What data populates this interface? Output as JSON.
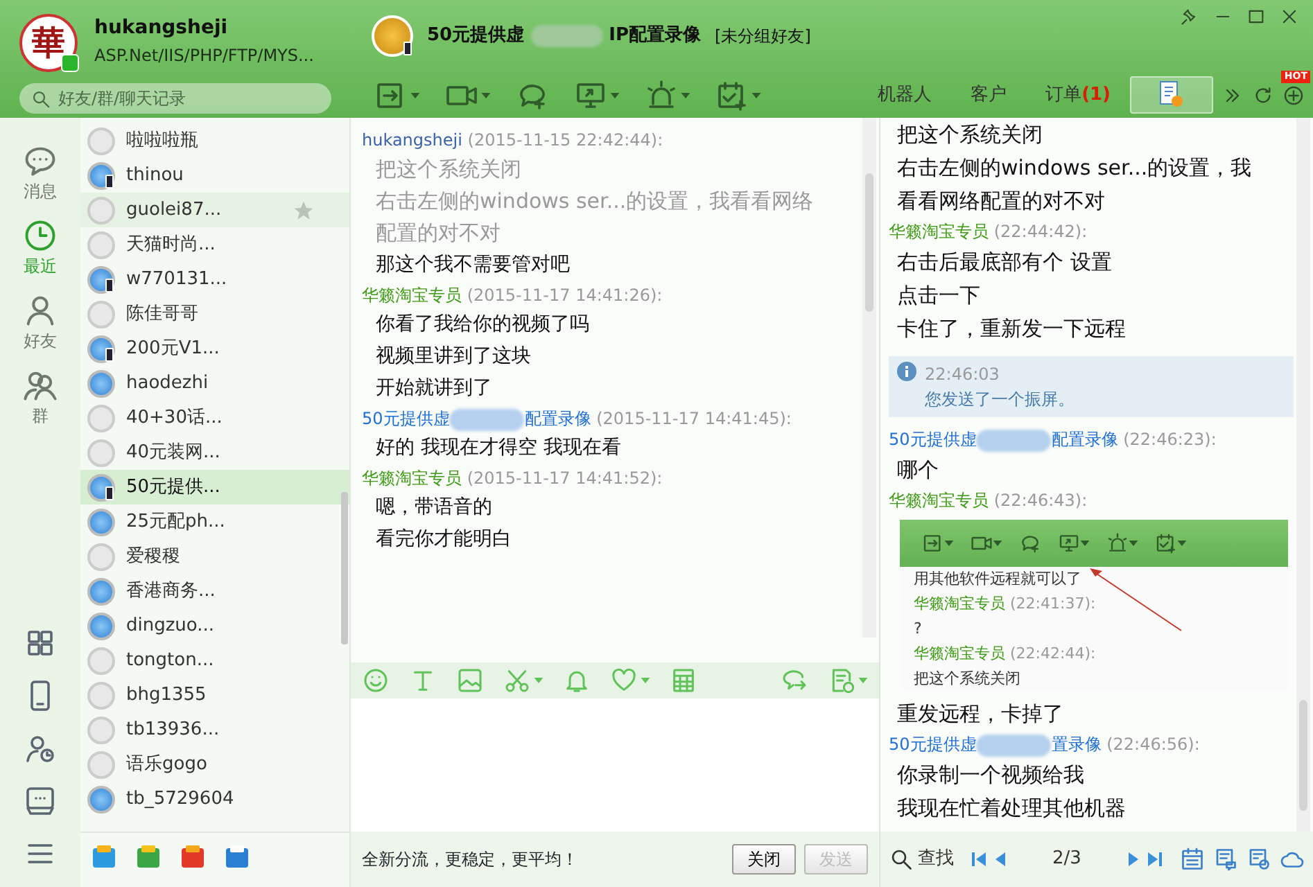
{
  "user": {
    "avatar_text": "華",
    "online": true,
    "name": "hukangsheji",
    "signature": "ASP.Net/IIS/PHP/FTP/MYS..."
  },
  "search": {
    "placeholder": "好友/群/聊天记录"
  },
  "chat_header": {
    "title_parts": [
      "50元提供虚",
      "IP配置录像"
    ],
    "group": "[未分组好友]",
    "mobile": true
  },
  "tabs": [
    {
      "kind": "text",
      "label": "机器人",
      "selected": false
    },
    {
      "kind": "text",
      "label": "客户",
      "selected": false
    },
    {
      "kind": "text",
      "label": "订单",
      "badge": "(1)",
      "selected": false
    },
    {
      "kind": "icon",
      "selected": true
    }
  ],
  "hot_badge": "HOT",
  "nav": [
    {
      "label": "消息",
      "selected": false
    },
    {
      "label": "最近",
      "selected": true
    },
    {
      "label": "好友",
      "selected": false
    },
    {
      "label": "群",
      "selected": false
    }
  ],
  "contacts": [
    {
      "name": "啦啦啦瓶",
      "online": false,
      "mobile": false,
      "selected": false,
      "hovered": false
    },
    {
      "name": "thinou",
      "online": true,
      "mobile": true,
      "selected": false,
      "hovered": false
    },
    {
      "name": "guolei87...",
      "online": false,
      "mobile": false,
      "selected": false,
      "hovered": true
    },
    {
      "name": "天猫时尚...",
      "online": false,
      "mobile": false,
      "selected": false,
      "hovered": false
    },
    {
      "name": "w770131...",
      "online": true,
      "mobile": true,
      "selected": false,
      "hovered": false
    },
    {
      "name": "陈佳哥哥",
      "online": false,
      "mobile": false,
      "selected": false,
      "hovered": false
    },
    {
      "name": "200元V1...",
      "online": true,
      "mobile": true,
      "selected": false,
      "hovered": false
    },
    {
      "name": "haodezhi",
      "online": true,
      "mobile": false,
      "selected": false,
      "hovered": false
    },
    {
      "name": "40+30话...",
      "online": false,
      "mobile": false,
      "selected": false,
      "hovered": false
    },
    {
      "name": "40元装网...",
      "online": false,
      "mobile": false,
      "selected": false,
      "hovered": false
    },
    {
      "name": "50元提供...",
      "online": true,
      "mobile": true,
      "selected": true,
      "hovered": false
    },
    {
      "name": "25元配ph...",
      "online": true,
      "mobile": false,
      "selected": false,
      "hovered": false
    },
    {
      "name": "爱稷稷",
      "online": false,
      "mobile": false,
      "selected": false,
      "hovered": false
    },
    {
      "name": "香港商务...",
      "online": true,
      "mobile": false,
      "selected": false,
      "hovered": false
    },
    {
      "name": "dingzuo...",
      "online": true,
      "mobile": false,
      "selected": false,
      "hovered": false
    },
    {
      "name": "tongton...",
      "online": false,
      "mobile": false,
      "selected": false,
      "hovered": false
    },
    {
      "name": "bhg1355",
      "online": false,
      "mobile": false,
      "selected": false,
      "hovered": false
    },
    {
      "name": "tb13936...",
      "online": false,
      "mobile": false,
      "selected": false,
      "hovered": false
    },
    {
      "name": "语乐gogo",
      "online": false,
      "mobile": false,
      "selected": false,
      "hovered": false
    },
    {
      "name": "tb_5729604",
      "online": true,
      "mobile": false,
      "selected": false,
      "hovered": false
    }
  ],
  "chat": [
    {
      "kind": "message",
      "color": "#3b62a6",
      "sender": [
        "hukangsheji"
      ],
      "time": "(2015-11-15 22:42:44):",
      "faded": true,
      "lines": [
        "把这个系统关闭",
        "右击左侧的windows ser...的设置，我看看网络",
        "配置的对不对"
      ]
    },
    {
      "kind": "message",
      "lines": [
        "那这个我不需要管对吧"
      ],
      "faded": false
    },
    {
      "kind": "message",
      "color": "#3e9a14",
      "sender": [
        "华籁淘宝专员"
      ],
      "time": "(2015-11-17 14:41:26):",
      "faded": false,
      "lines": [
        "你看了我给你的视频了吗",
        "视频里讲到了这块",
        "开始就讲到了"
      ]
    },
    {
      "kind": "message",
      "color": "#1f6fd3",
      "sender": [
        "50元提供虚",
        "配置录像"
      ],
      "time": "(2015-11-17 14:41:45):",
      "faded": false,
      "lines": [
        "好的 我现在才得空 我现在看"
      ]
    },
    {
      "kind": "message",
      "color": "#3e9a14",
      "sender": [
        "华籁淘宝专员"
      ],
      "time": "(2015-11-17 14:41:52):",
      "faded": false,
      "lines": [
        "嗯，带语音的",
        "看完你才能明白"
      ]
    }
  ],
  "footer_notice": "全新分流，更稳定，更平均！",
  "buttons": [
    {
      "label": "关闭",
      "disabled": false
    },
    {
      "label": "发送",
      "disabled": true
    }
  ],
  "history": [
    {
      "kind": "message",
      "lines": [
        "把这个系统关闭",
        "右击左侧的windows ser...的设置，我",
        "看看网络配置的对不对"
      ],
      "faded": false
    },
    {
      "kind": "message",
      "color": "#3e9a14",
      "sender": [
        "华籁淘宝专员"
      ],
      "time": "(22:44:42):",
      "faded": false,
      "lines": [
        "右击后最底部有个 设置",
        "点击一下",
        "卡住了，重新发一下远程"
      ]
    },
    {
      "kind": "notice",
      "time": "22:46:03",
      "text": "您发送了一个振屏。"
    },
    {
      "kind": "message",
      "color": "#1f6fd3",
      "sender": [
        "50元提供虚",
        "配置录像"
      ],
      "time": "(22:46:23):",
      "faded": false,
      "lines": [
        "哪个"
      ]
    },
    {
      "kind": "message",
      "color": "#3e9a14",
      "sender": [
        "华籁淘宝专员"
      ],
      "time": "(22:46:43):",
      "faded": false,
      "screenshot": [
        {
          "kind": "text",
          "text": "用其他软件远程就可以了"
        },
        {
          "kind": "header",
          "sender": "华籁淘宝专员",
          "time": "(22:41:37):"
        },
        {
          "kind": "text",
          "text": "?"
        },
        {
          "kind": "header",
          "sender": "华籁淘宝专员",
          "time": "(22:42:44):"
        },
        {
          "kind": "text",
          "text": "把这个系统关闭"
        }
      ],
      "lines": [
        "重发远程，卡掉了"
      ]
    },
    {
      "kind": "message",
      "color": "#1f6fd3",
      "sender": [
        "50元提供虚",
        "置录像"
      ],
      "time": "(22:46:56):",
      "faded": false,
      "lines": [
        "你录制一个视频给我",
        "我现在忙着处理其他机器"
      ]
    }
  ],
  "history_footer": {
    "find": "查找",
    "page": "2/3"
  }
}
